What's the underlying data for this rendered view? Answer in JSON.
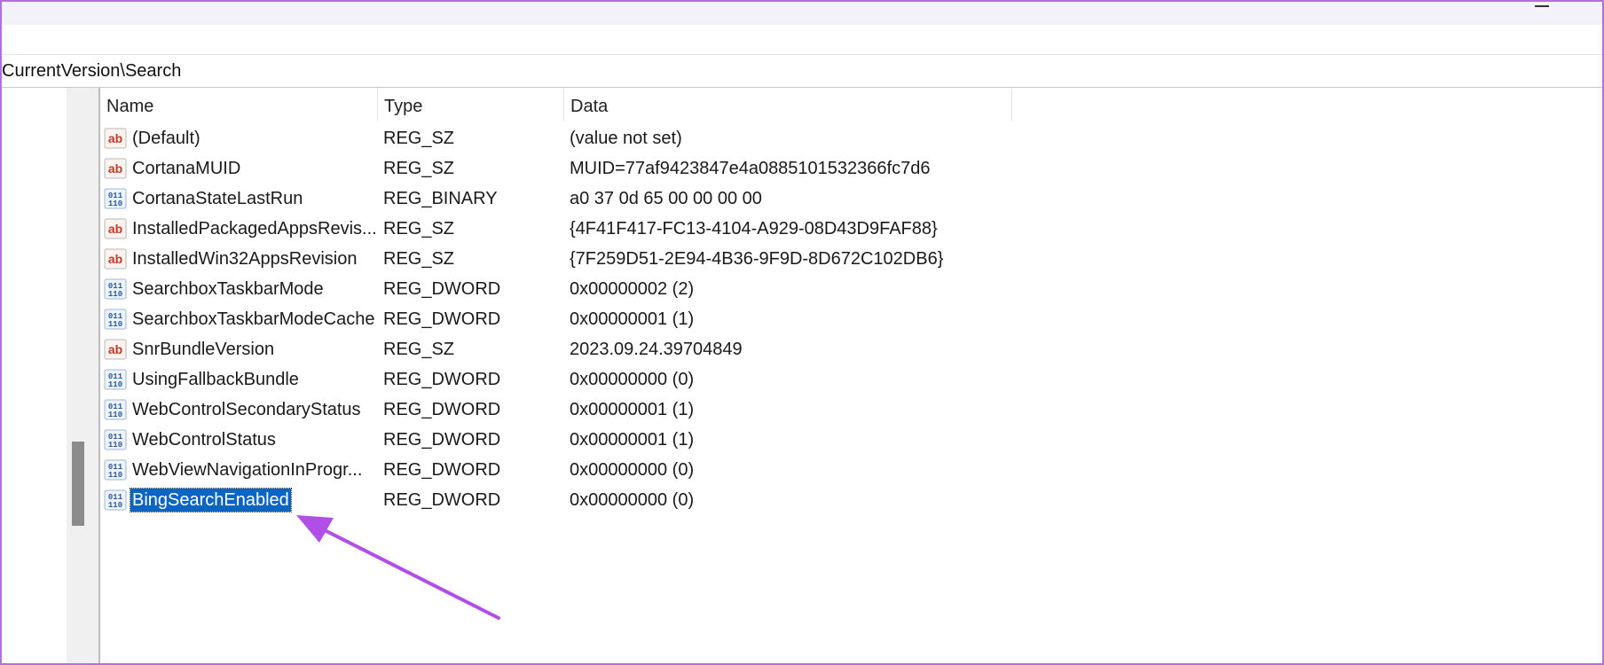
{
  "address": {
    "path": "CurrentVersion\\Search"
  },
  "columns": {
    "name": "Name",
    "type": "Type",
    "data": "Data"
  },
  "icons": {
    "string": "ab-string-icon",
    "binary": "binary-value-icon"
  },
  "colors": {
    "accent": "#b36ee0",
    "selection": "#0a64c2",
    "string_icon": "#c0392b",
    "binary_icon": "#2c5aa0"
  },
  "rows": [
    {
      "name": "(Default)",
      "type": "REG_SZ",
      "data": "(value not set)",
      "icon": "string"
    },
    {
      "name": "CortanaMUID",
      "type": "REG_SZ",
      "data": "MUID=77af9423847e4a0885101532366fc7d6",
      "icon": "string"
    },
    {
      "name": "CortanaStateLastRun",
      "type": "REG_BINARY",
      "data": "a0 37 0d 65 00 00 00 00",
      "icon": "binary"
    },
    {
      "name": "InstalledPackagedAppsRevis...",
      "type": "REG_SZ",
      "data": "{4F41F417-FC13-4104-A929-08D43D9FAF88}",
      "icon": "string"
    },
    {
      "name": "InstalledWin32AppsRevision",
      "type": "REG_SZ",
      "data": "{7F259D51-2E94-4B36-9F9D-8D672C102DB6}",
      "icon": "string"
    },
    {
      "name": "SearchboxTaskbarMode",
      "type": "REG_DWORD",
      "data": "0x00000002 (2)",
      "icon": "binary"
    },
    {
      "name": "SearchboxTaskbarModeCache",
      "type": "REG_DWORD",
      "data": "0x00000001 (1)",
      "icon": "binary"
    },
    {
      "name": "SnrBundleVersion",
      "type": "REG_SZ",
      "data": "2023.09.24.39704849",
      "icon": "string"
    },
    {
      "name": "UsingFallbackBundle",
      "type": "REG_DWORD",
      "data": "0x00000000 (0)",
      "icon": "binary"
    },
    {
      "name": "WebControlSecondaryStatus",
      "type": "REG_DWORD",
      "data": "0x00000001 (1)",
      "icon": "binary"
    },
    {
      "name": "WebControlStatus",
      "type": "REG_DWORD",
      "data": "0x00000001 (1)",
      "icon": "binary"
    },
    {
      "name": "WebViewNavigationInProgr...",
      "type": "REG_DWORD",
      "data": "0x00000000 (0)",
      "icon": "binary"
    },
    {
      "name": "BingSearchEnabled",
      "type": "REG_DWORD",
      "data": "0x00000000 (0)",
      "icon": "binary",
      "selected": true
    }
  ]
}
